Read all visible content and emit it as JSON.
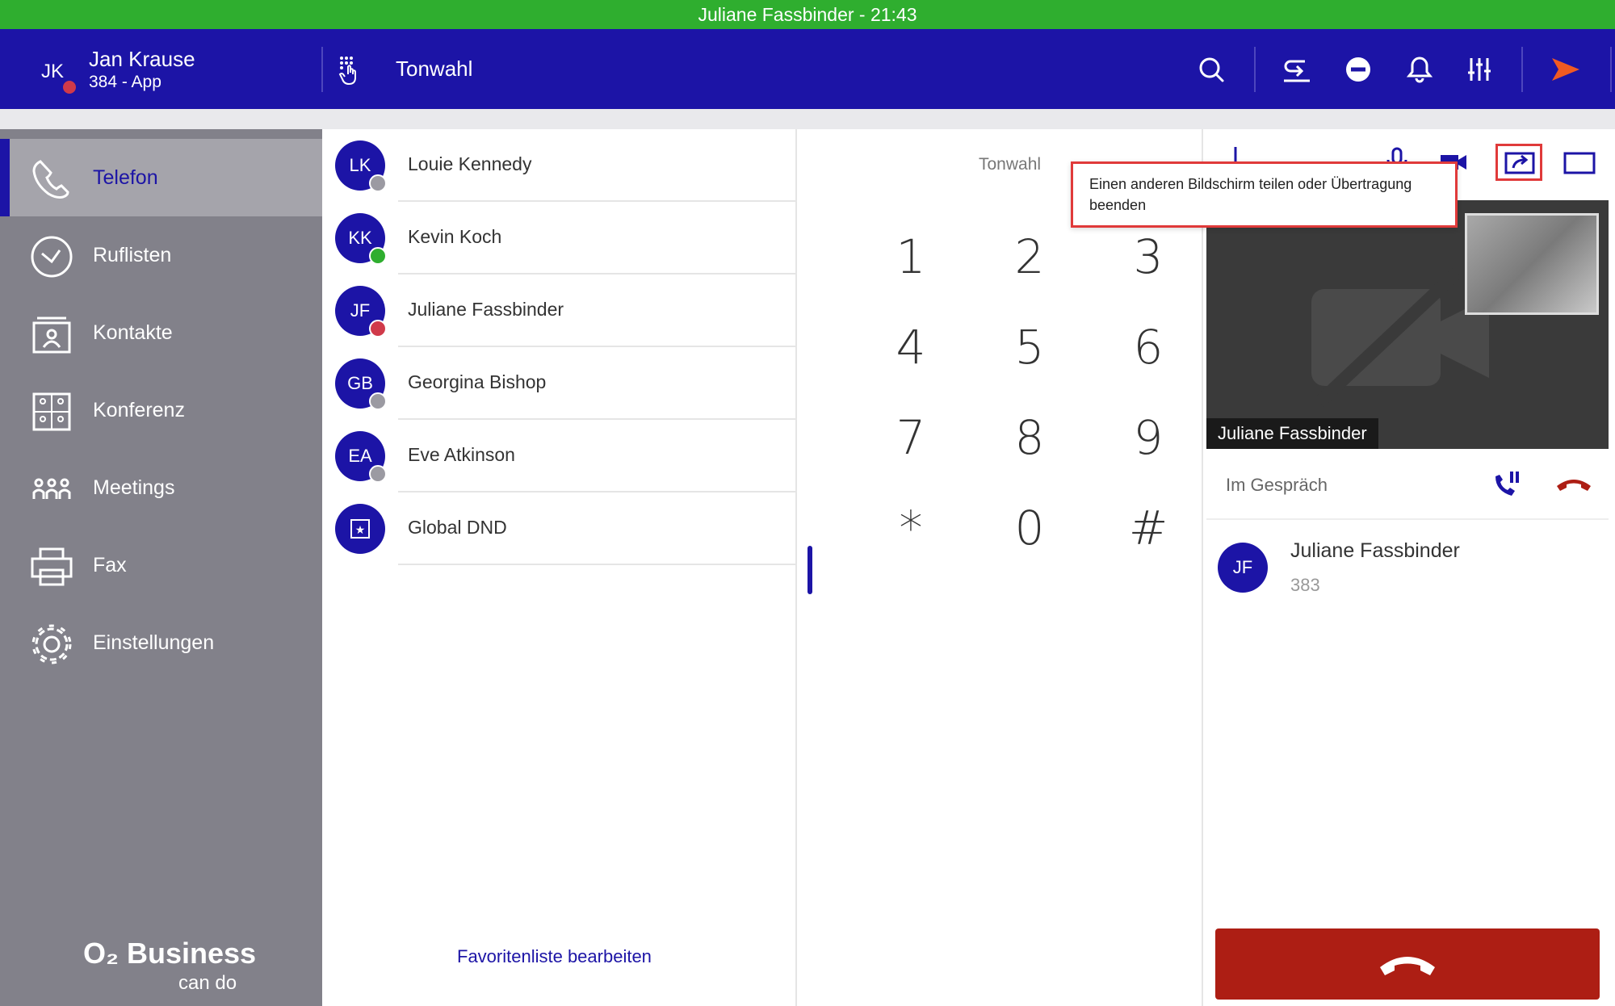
{
  "window": {
    "status_title": "Juliane Fassbinder - 21:43"
  },
  "header": {
    "user_initials": "JK",
    "user_name": "Jan Krause",
    "user_ext": "384 - App",
    "tone_label": "Tonwahl"
  },
  "sidebar": {
    "items": [
      {
        "label": "Telefon",
        "icon": "phone-icon"
      },
      {
        "label": "Ruflisten",
        "icon": "clock-icon"
      },
      {
        "label": "Kontakte",
        "icon": "contacts-icon"
      },
      {
        "label": "Konferenz",
        "icon": "conference-icon"
      },
      {
        "label": "Meetings",
        "icon": "meetings-icon"
      },
      {
        "label": "Fax",
        "icon": "fax-icon"
      },
      {
        "label": "Einstellungen",
        "icon": "gear-icon"
      }
    ],
    "brand_main": "O₂ Business",
    "brand_sub": "can do"
  },
  "favorites": {
    "items": [
      {
        "initials": "LK",
        "name": "Louie Kennedy",
        "status": "grey"
      },
      {
        "initials": "KK",
        "name": "Kevin Koch",
        "status": "green"
      },
      {
        "initials": "JF",
        "name": "Juliane Fassbinder",
        "status": "red"
      },
      {
        "initials": "GB",
        "name": "Georgina Bishop",
        "status": "grey"
      },
      {
        "initials": "EA",
        "name": "Eve Atkinson",
        "status": "grey"
      },
      {
        "initials": "",
        "name": "Global DND",
        "status": "none"
      }
    ],
    "edit_label": "Favoritenliste bearbeiten"
  },
  "dialpad": {
    "title": "Tonwahl",
    "keys": [
      "1",
      "2",
      "3",
      "4",
      "5",
      "6",
      "7",
      "8",
      "9",
      "*",
      "0",
      "#"
    ]
  },
  "call": {
    "tooltip": "Einen anderen Bildschirm teilen oder Übertragung beenden",
    "video_name": "Juliane Fassbinder",
    "status": "Im Gespräch",
    "caller_initials": "JF",
    "caller_name": "Juliane Fassbinder",
    "caller_ext": "383"
  },
  "colors": {
    "status_green": "#2fae2f",
    "brand_blue": "#1c14a6",
    "sidebar_grey": "#82818a",
    "hangup_red": "#ad1e14",
    "accent_orange": "#f15a22"
  }
}
